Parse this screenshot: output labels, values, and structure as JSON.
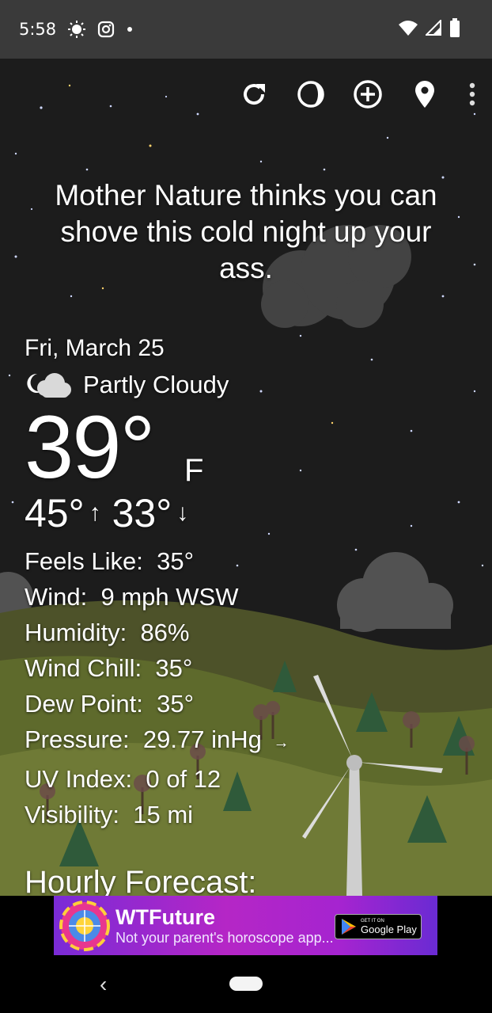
{
  "status_bar": {
    "time": "5:58",
    "icons": [
      "brightness-icon",
      "instagram-icon",
      "notification-dot",
      "wifi-icon",
      "signal-icon",
      "battery-icon"
    ]
  },
  "toolbar": {
    "icons": [
      "refresh-icon",
      "moon-phase-icon",
      "add-location-icon",
      "location-pin-icon",
      "more-vert-icon"
    ]
  },
  "quote": "Mother Nature thinks you can shove this cold night up your ass.",
  "weather": {
    "date": "Fri, March 25",
    "condition": "Partly Cloudy",
    "condition_icon": "night-partly-cloudy-icon",
    "temperature": "39°",
    "unit": "F",
    "high": "45°",
    "high_arrow": "↑",
    "low": "33°",
    "low_arrow": "↓",
    "details": [
      {
        "label": "Feels Like:",
        "value": "35°"
      },
      {
        "label": "Wind:",
        "value": "9 mph WSW"
      },
      {
        "label": "Humidity:",
        "value": "86%"
      },
      {
        "label": "Wind Chill:",
        "value": "35°"
      },
      {
        "label": "Dew Point:",
        "value": "35°"
      },
      {
        "label": "Pressure:",
        "value": "29.77 inHg",
        "trend": "→"
      },
      {
        "label": "UV Index:",
        "value": "0 of 12"
      },
      {
        "label": "Visibility:",
        "value": "15 mi"
      }
    ]
  },
  "hourly_title": "Hourly Forecast:",
  "ad": {
    "title": "WTFuture",
    "subtitle": "Not your parent's horoscope app...",
    "store_small": "GET IT ON",
    "store_name": "Google Play"
  },
  "navigation": {
    "back": "‹"
  },
  "colors": {
    "status_bar": "#3a3a3a",
    "sky": "#1c1c1c",
    "ad_gradient_start": "#7a2bd6",
    "ad_gradient_mid": "#b526c6"
  }
}
